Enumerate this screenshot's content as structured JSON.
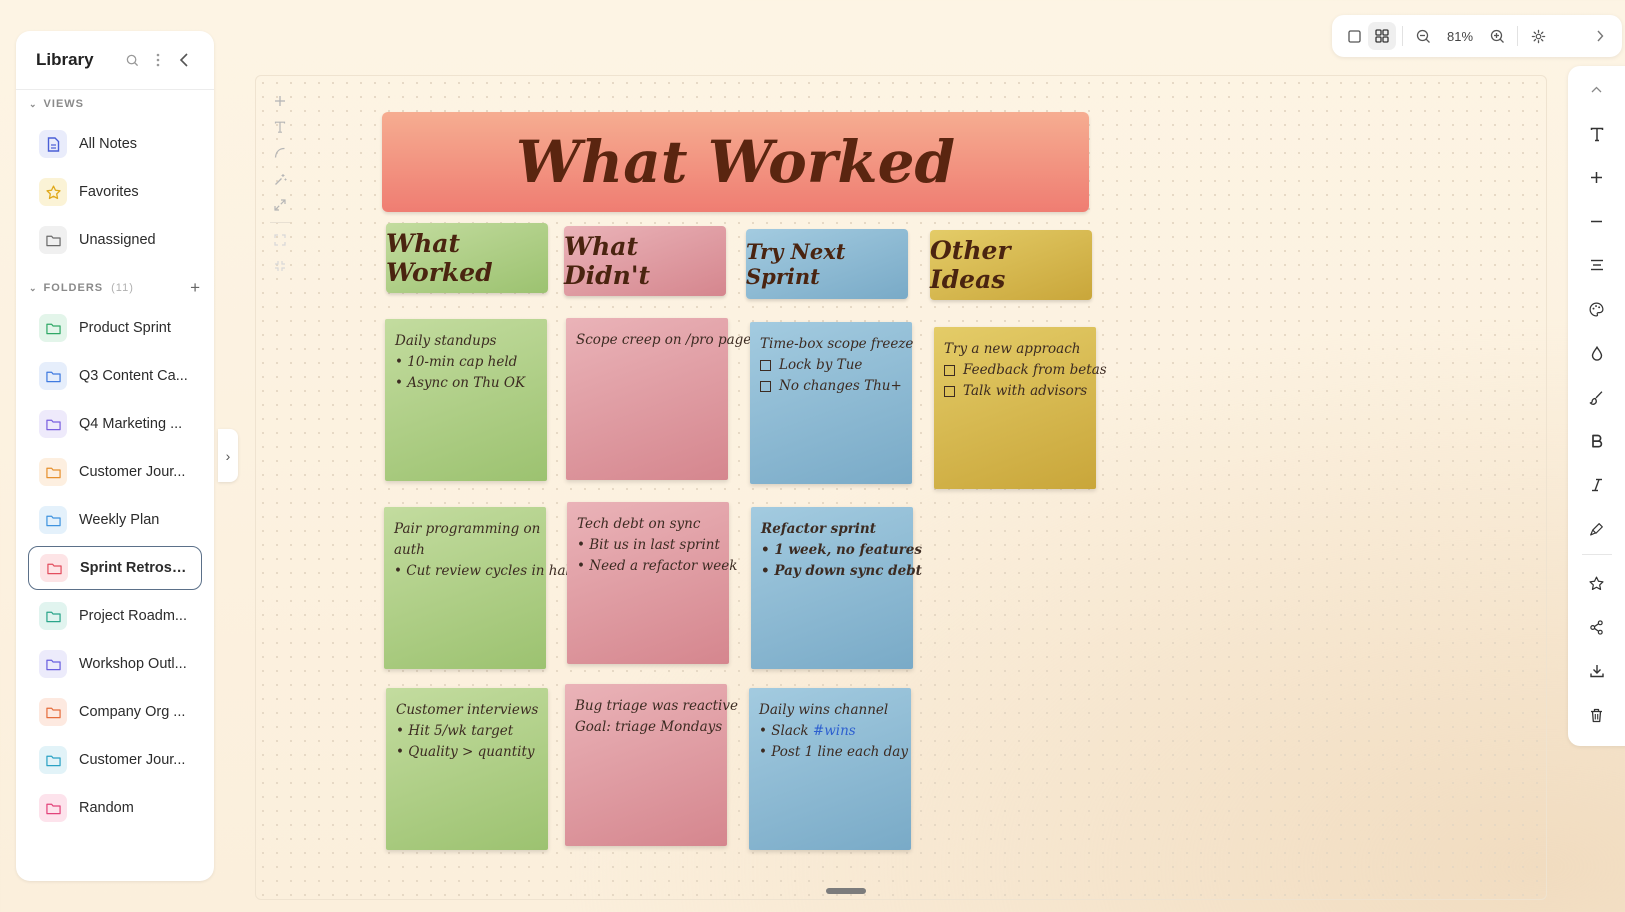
{
  "sidebar": {
    "title": "Library",
    "views_label": "VIEWS",
    "views": [
      {
        "label": "All Notes",
        "icon": "document-icon",
        "bg": "#e9ecfb",
        "fg": "#4a5fd6"
      },
      {
        "label": "Favorites",
        "icon": "star-icon",
        "bg": "#fbf3d6",
        "fg": "#e0a91c"
      },
      {
        "label": "Unassigned",
        "icon": "folder-icon",
        "bg": "#f0f0f0",
        "fg": "#6a6a6a"
      }
    ],
    "folders_label": "FOLDERS",
    "folders_count": "(11)",
    "folders": [
      {
        "label": "Product Sprint",
        "bg": "#e3f5ea",
        "fg": "#2fa866"
      },
      {
        "label": "Q3 Content Ca...",
        "bg": "#e6eefb",
        "fg": "#3f7ae0"
      },
      {
        "label": "Q4 Marketing ...",
        "bg": "#eeeafb",
        "fg": "#7a5fe0"
      },
      {
        "label": "Customer Jour...",
        "bg": "#fdefe0",
        "fg": "#e6902e"
      },
      {
        "label": "Weekly Plan",
        "bg": "#e4f1fb",
        "fg": "#3f93df"
      },
      {
        "label": "Sprint Retrosp...",
        "bg": "#fde4e6",
        "fg": "#e34d5e",
        "active": true
      },
      {
        "label": "Project Roadm...",
        "bg": "#e1f4ef",
        "fg": "#2ba58a"
      },
      {
        "label": "Workshop Outl...",
        "bg": "#ecebfb",
        "fg": "#6a5fe0"
      },
      {
        "label": "Company Org ...",
        "bg": "#fde9e0",
        "fg": "#e56d3c"
      },
      {
        "label": "Customer Jour...",
        "bg": "#e2f3f8",
        "fg": "#2aa2c4"
      },
      {
        "label": "Random",
        "bg": "#fde3ec",
        "fg": "#e2427a"
      }
    ]
  },
  "toolbar": {
    "zoom": "81%"
  },
  "board": {
    "banner": "What Worked",
    "columns": [
      {
        "title": "What Worked",
        "color": "green"
      },
      {
        "title": "What Didn't",
        "color": "pink"
      },
      {
        "title": "Try Next Sprint",
        "color": "blue"
      },
      {
        "title": "Other Ideas",
        "color": "gold"
      }
    ],
    "notes": [
      {
        "col": 0,
        "lines": [
          "Daily standups",
          "• 10-min cap held",
          "• Async on Thu OK"
        ]
      },
      {
        "col": 0,
        "lines": [
          "Pair programming on",
          "auth",
          "• Cut review cycles in half"
        ]
      },
      {
        "col": 0,
        "lines": [
          "Customer interviews",
          "• Hit 5/wk target",
          "• Quality > quantity"
        ]
      },
      {
        "col": 1,
        "lines": [
          "Scope creep on /pro page"
        ]
      },
      {
        "col": 1,
        "lines": [
          "Tech debt on sync",
          "• Bit us in last sprint",
          "• Need a refactor week"
        ]
      },
      {
        "col": 1,
        "lines": [
          "Bug triage was reactive",
          "Goal: triage Mondays"
        ]
      },
      {
        "col": 2,
        "lines": [
          "Time-box scope freeze",
          "Lock by Tue",
          "No changes Thu+"
        ]
      },
      {
        "col": 2,
        "lines": [
          "Refactor sprint",
          "• 1 week, no features",
          "• Pay down sync debt"
        ]
      },
      {
        "col": 2,
        "lines": [
          "Daily wins channel",
          "• Slack ",
          "#wins",
          "• Post 1 line each day"
        ]
      },
      {
        "col": 3,
        "lines": [
          "Try a new approach",
          "Feedback from betas",
          "Talk with advisors"
        ]
      }
    ]
  }
}
